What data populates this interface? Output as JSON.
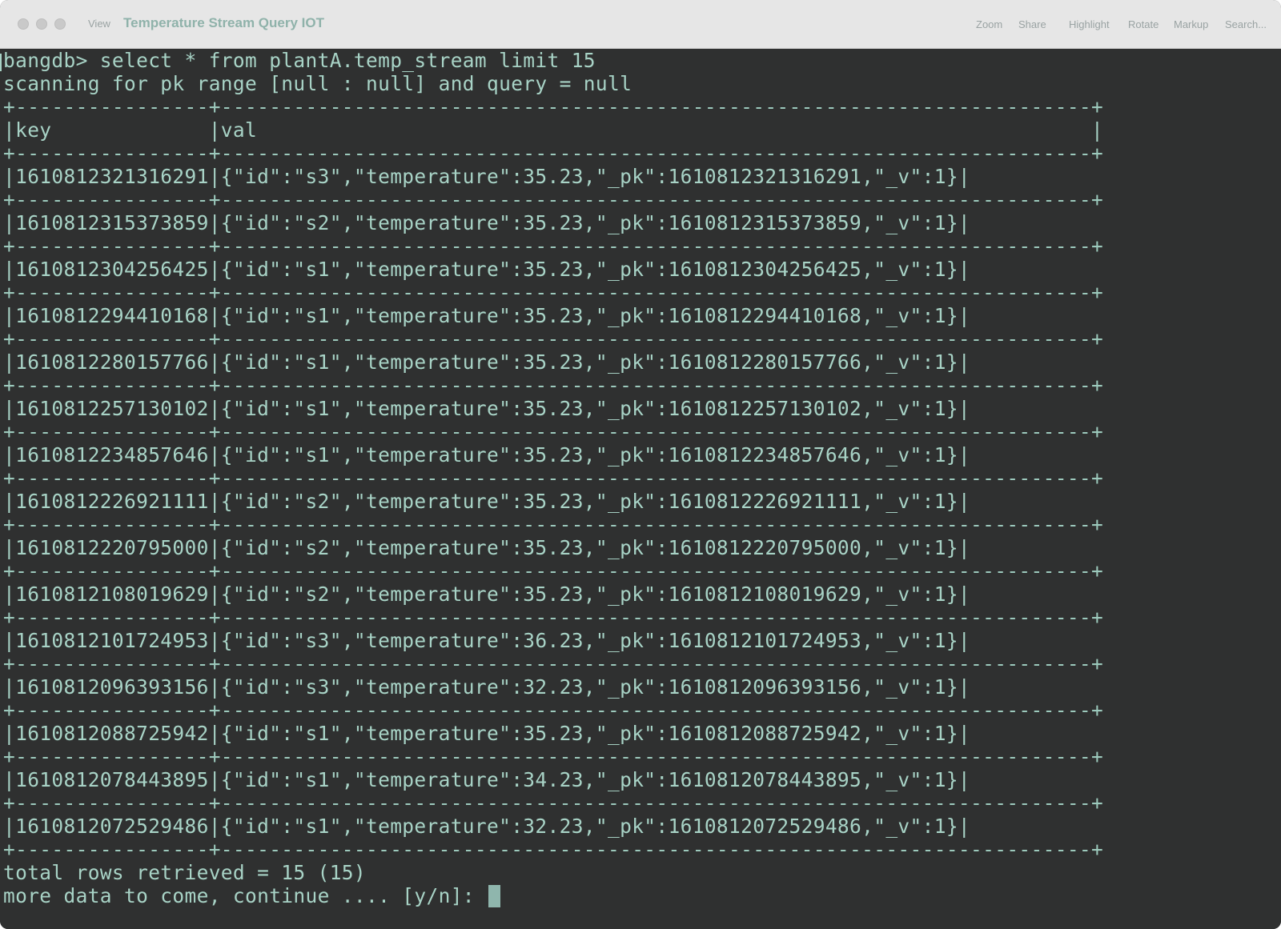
{
  "titlebar": {
    "view_label": "View",
    "title": "Temperature Stream Query IOT",
    "zoom_label": "Zoom",
    "share_label": "Share",
    "highlight_label": "Highlight",
    "rotate_label": "Rotate",
    "markup_label": "Markup",
    "search_label": "Search..."
  },
  "terminal": {
    "command_line": "bangdb> select * from plantA.temp_stream limit 15",
    "scan_line": "scanning for pk range [null : null] and query = null",
    "separator": "+----------------+------------------------------------------------------------------------+",
    "header_line": "|key             |val                                                                     |",
    "rows": [
      "|1610812321316291|{\"id\":\"s3\",\"temperature\":35.23,\"_pk\":1610812321316291,\"_v\":1}|",
      "|1610812315373859|{\"id\":\"s2\",\"temperature\":35.23,\"_pk\":1610812315373859,\"_v\":1}|",
      "|1610812304256425|{\"id\":\"s1\",\"temperature\":35.23,\"_pk\":1610812304256425,\"_v\":1}|",
      "|1610812294410168|{\"id\":\"s1\",\"temperature\":35.23,\"_pk\":1610812294410168,\"_v\":1}|",
      "|1610812280157766|{\"id\":\"s1\",\"temperature\":35.23,\"_pk\":1610812280157766,\"_v\":1}|",
      "|1610812257130102|{\"id\":\"s1\",\"temperature\":35.23,\"_pk\":1610812257130102,\"_v\":1}|",
      "|1610812234857646|{\"id\":\"s1\",\"temperature\":35.23,\"_pk\":1610812234857646,\"_v\":1}|",
      "|1610812226921111|{\"id\":\"s2\",\"temperature\":35.23,\"_pk\":1610812226921111,\"_v\":1}|",
      "|1610812220795000|{\"id\":\"s2\",\"temperature\":35.23,\"_pk\":1610812220795000,\"_v\":1}|",
      "|1610812108019629|{\"id\":\"s2\",\"temperature\":35.23,\"_pk\":1610812108019629,\"_v\":1}|",
      "|1610812101724953|{\"id\":\"s3\",\"temperature\":36.23,\"_pk\":1610812101724953,\"_v\":1}|",
      "|1610812096393156|{\"id\":\"s3\",\"temperature\":32.23,\"_pk\":1610812096393156,\"_v\":1}|",
      "|1610812088725942|{\"id\":\"s1\",\"temperature\":35.23,\"_pk\":1610812088725942,\"_v\":1}|",
      "|1610812078443895|{\"id\":\"s1\",\"temperature\":34.23,\"_pk\":1610812078443895,\"_v\":1}|",
      "|1610812072529486|{\"id\":\"s1\",\"temperature\":32.23,\"_pk\":1610812072529486,\"_v\":1}|"
    ],
    "total_line": "total rows retrieved = 15 (15)",
    "continue_prompt": "more data to come, continue .... [y/n]: "
  }
}
